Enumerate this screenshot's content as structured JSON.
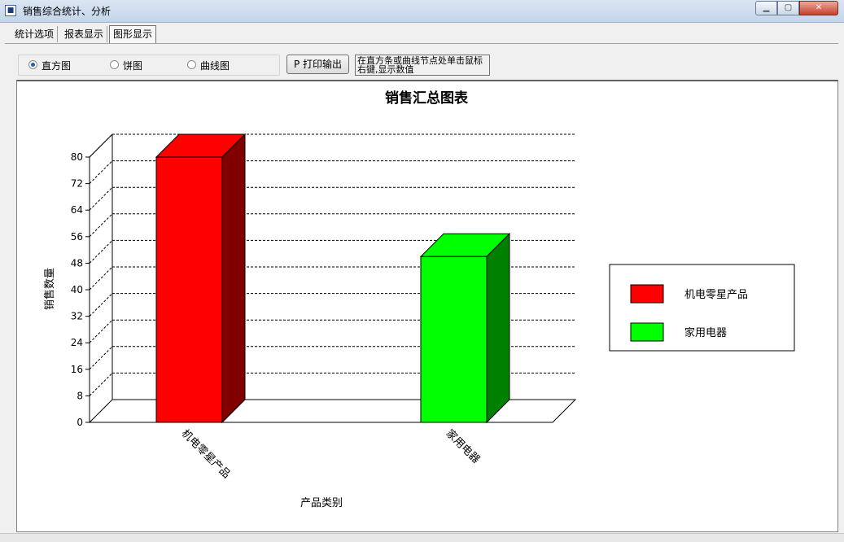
{
  "window": {
    "title": "销售综合统计、分析",
    "icon_name": "app-icon"
  },
  "tabs": [
    {
      "label": "统计选项",
      "active": false
    },
    {
      "label": "报表显示",
      "active": false
    },
    {
      "label": "图形显示",
      "active": true
    }
  ],
  "chart_options": {
    "bar_label": "直方图",
    "pie_label": "饼图",
    "line_label": "曲线图",
    "selected": "bar"
  },
  "print_button": {
    "label": "P  打印输出"
  },
  "hint": {
    "text": "在直方条或曲线节点处单击鼠标右键,显示数值"
  },
  "chart_data": {
    "type": "bar",
    "title": "销售汇总图表",
    "xlabel": "产品类别",
    "ylabel": "销售数量",
    "categories": [
      "机电零星产品",
      "家用电器"
    ],
    "values": [
      80,
      50
    ],
    "ylim": [
      0,
      80
    ],
    "yticks": [
      0,
      8,
      16,
      24,
      32,
      40,
      48,
      56,
      64,
      72,
      80
    ],
    "grid": true,
    "three_d": true,
    "legend_position": "right",
    "colors": [
      "#ff0000",
      "#00ff00"
    ],
    "side_colors": [
      "#800000",
      "#008000"
    ],
    "legend": [
      "机电零星产品",
      "家用电器"
    ]
  }
}
